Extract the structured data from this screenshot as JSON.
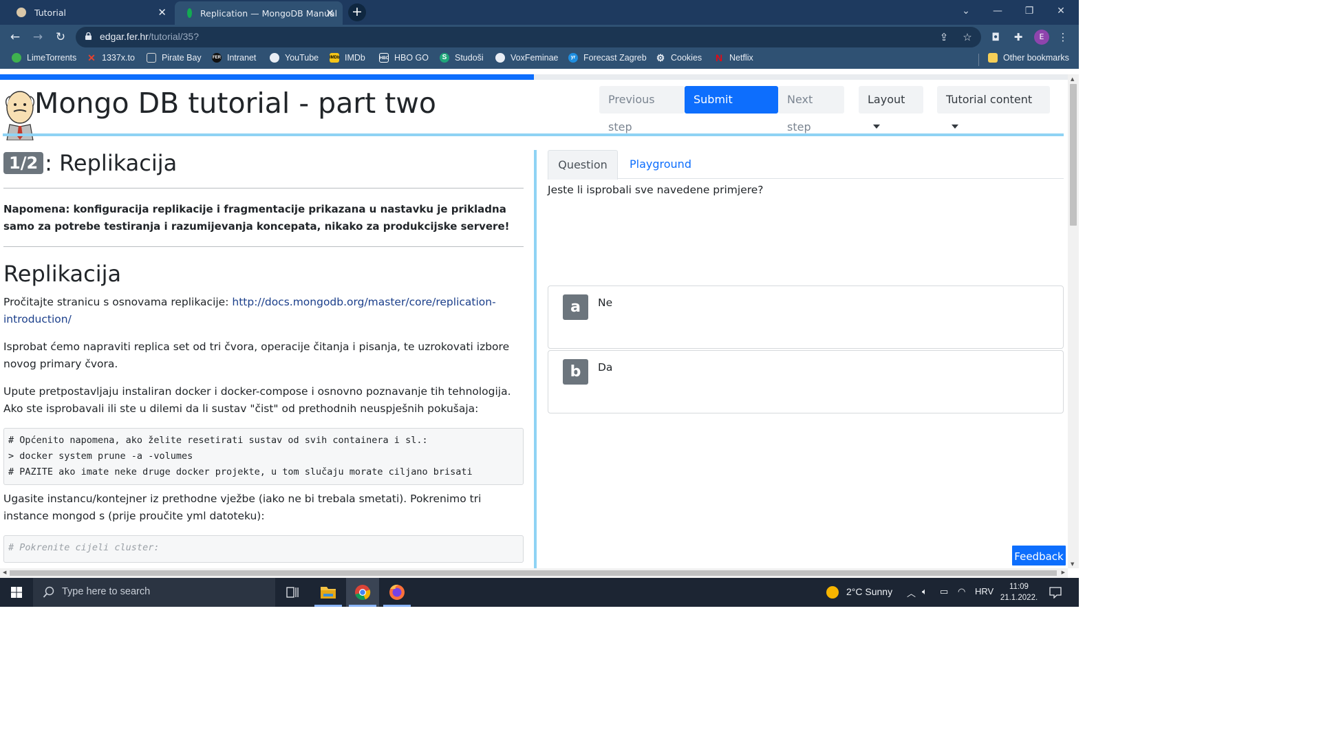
{
  "browser": {
    "tabs": [
      {
        "title": "Tutorial",
        "active": false
      },
      {
        "title": "Replication — MongoDB Manual",
        "active": true
      }
    ],
    "url_host": "edgar.fer.hr",
    "url_path": "/tutorial/35?",
    "profile_initial": "E",
    "bookmarks": [
      {
        "label": "LimeTorrents",
        "icon": "lime-icon",
        "color": "#3fb24f"
      },
      {
        "label": "1337x.to",
        "icon": "x-icon",
        "color": "#e8422e"
      },
      {
        "label": "Pirate Bay",
        "icon": "pirate-icon",
        "color": "#d8d8d8"
      },
      {
        "label": "Intranet",
        "icon": "fer-icon",
        "color": "#222222"
      },
      {
        "label": "YouTube",
        "icon": "globe-icon",
        "color": "#e9eef5"
      },
      {
        "label": "IMDb",
        "icon": "imdb-icon",
        "color": "#f5c518"
      },
      {
        "label": "HBO GO",
        "icon": "hbo-icon",
        "color": "#ffffff"
      },
      {
        "label": "Studoši",
        "icon": "studosi-icon",
        "color": "#1fa67a"
      },
      {
        "label": "VoxFeminae",
        "icon": "globe-icon",
        "color": "#e9eef5"
      },
      {
        "label": "Forecast Zagreb",
        "icon": "yr-icon",
        "color": "#1f8ee0"
      },
      {
        "label": "Cookies",
        "icon": "gear-icon",
        "color": "#e9eef5"
      },
      {
        "label": "Netflix",
        "icon": "netflix-icon",
        "color": "#e50914"
      }
    ],
    "other_bookmarks": "Other bookmarks"
  },
  "progress": {
    "fraction": 0.5
  },
  "header": {
    "title": "Mongo DB tutorial - part two",
    "prev_label": "Previous step",
    "submit_label": "Submit answer",
    "next_label": "Next step",
    "layout_label": "Layout",
    "content_label": "Tutorial content"
  },
  "lesson": {
    "badge": "1/2",
    "step_title": ": Replikacija",
    "note": "Napomena: konfiguracija replikacije i fragmentacije prikazana u nastavku je prikladna samo za potrebe testiranja i razumijevanja koncepata, nikako za produkcijske servere!",
    "heading": "Replikacija",
    "p1_text": "Pročitajte stranicu s osnovama replikacije: ",
    "p1_link": "http://docs.mongodb.org/master/core/replication-introduction/",
    "p2": "Isprobat ćemo napraviti replica set od tri čvora, operacije čitanja i pisanja, te uzrokovati izbore novog primary čvora.",
    "p3": "Upute pretpostavljaju instaliran docker i docker-compose i osnovno poznavanje tih tehnologija. Ako ste isprobavali ili ste u dilemi da li sustav \"čist\" od prethodnih neuspješnih pokušaja:",
    "code1": "# Općenito napomena, ako želite resetirati sustav od svih containera i sl.:\n> docker system prune -a -volumes\n# PAZITE ako imate neke druge docker projekte, u tom slučaju morate ciljano brisati",
    "p4": "Ugasite instancu/kontejner iz prethodne vježbe (iako ne bi trebala smetati). Pokrenimo tri instance mongod s (prije proučite yml datoteku):",
    "code2": "# Pokrenite cijeli cluster:"
  },
  "quiz": {
    "tab_question": "Question",
    "tab_playground": "Playground",
    "question": "Jeste li isprobali sve navedene primjere?",
    "answers": [
      {
        "letter": "a",
        "text": "Ne"
      },
      {
        "letter": "b",
        "text": "Da"
      }
    ]
  },
  "feedback_label": "Feedback",
  "taskbar": {
    "search_placeholder": "Type here to search",
    "weather": "2°C  Sunny",
    "language": "HRV",
    "time": "11:09",
    "date": "21.1.2022."
  }
}
